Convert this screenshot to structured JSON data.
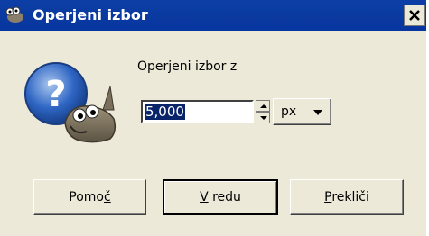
{
  "window": {
    "title": "Operjeni izbor"
  },
  "dialog": {
    "prompt_label": "Operjeni izbor z",
    "value": "5,000",
    "unit": "px"
  },
  "buttons": {
    "help": {
      "pre": "Pomo",
      "mnemonic": "č",
      "post": ""
    },
    "ok": {
      "pre": "",
      "mnemonic": "V",
      "post": " redu"
    },
    "cancel": {
      "pre": "",
      "mnemonic": "P",
      "post": "rekliči"
    }
  },
  "colors": {
    "titlebar": "#0a3aa0",
    "dialog_bg": "#ece9d8",
    "selection": "#0a246a"
  }
}
